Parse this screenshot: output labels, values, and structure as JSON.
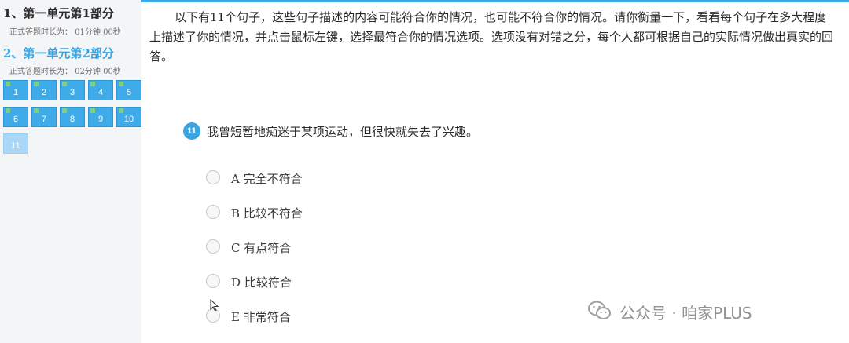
{
  "sidebar": {
    "sections": [
      {
        "title": "1、第一单元第1部分",
        "time": "正式答题时长为： 01分钟 00秒"
      },
      {
        "title": "2、第一单元第2部分",
        "time": "正式答题时长为： 02分钟 00秒"
      }
    ],
    "questions": [
      "1",
      "2",
      "3",
      "4",
      "5",
      "6",
      "7",
      "8",
      "9",
      "10",
      "11"
    ],
    "current_question": "11"
  },
  "instructions": "以下有11个句子，这些句子描述的内容可能符合你的情况，也可能不符合你的情况。请你衡量一下，看看每个句子在多大程度上描述了你的情况，并点击鼠标左键，选择最符合你的情况选项。选项没有对错之分，每个人都可根据自己的实际情况做出真实的回答。",
  "question": {
    "number": "11",
    "text": "我曾短暂地痴迷于某项运动，但很快就失去了兴趣。"
  },
  "options": [
    {
      "letter": "A",
      "label": "完全不符合"
    },
    {
      "letter": "B",
      "label": "比较不符合"
    },
    {
      "letter": "C",
      "label": "有点符合"
    },
    {
      "letter": "D",
      "label": "比较符合"
    },
    {
      "letter": "E",
      "label": "非常符合"
    }
  ],
  "watermark": {
    "text": "公众号 · 咱家PLUS",
    "icon": "wechat-icon"
  },
  "colors": {
    "accent": "#39a5e3",
    "cell": "#3fabe9",
    "cell_current": "#a9d8f6"
  }
}
